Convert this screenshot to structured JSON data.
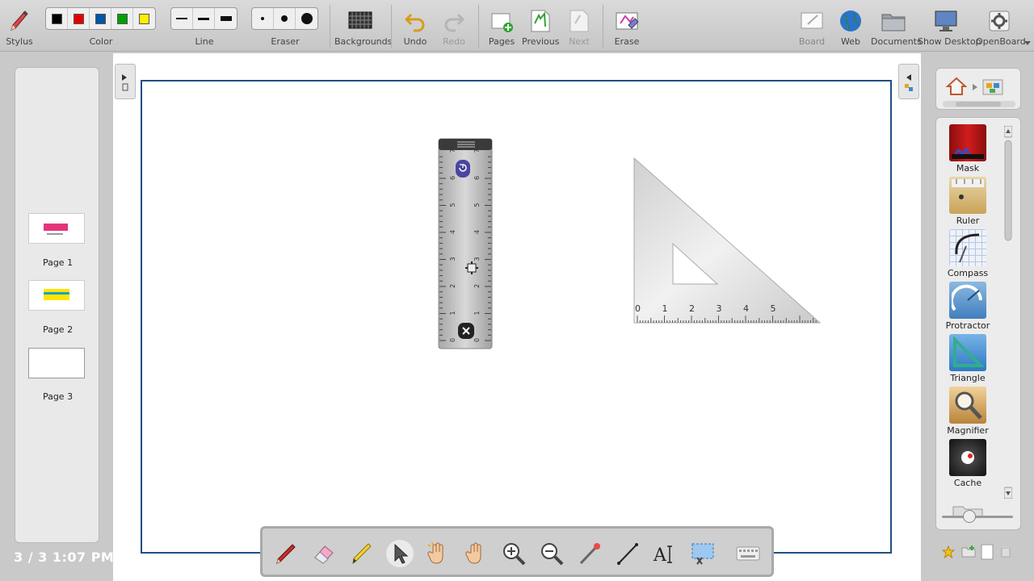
{
  "toolbar": {
    "stylus": "Stylus",
    "color": "Color",
    "line": "Line",
    "eraser": "Eraser",
    "backgrounds": "Backgrounds",
    "undo": "Undo",
    "redo": "Redo",
    "pages": "Pages",
    "previous": "Previous",
    "next": "Next",
    "erase": "Erase",
    "board": "Board",
    "web": "Web",
    "documents": "Documents",
    "show_desktop": "Show Desktop",
    "openboard": "OpenBoard",
    "colors": [
      "#000000",
      "#e60000",
      "#0055a5",
      "#00a000",
      "#ffee00"
    ]
  },
  "pages": [
    {
      "label": "Page 1"
    },
    {
      "label": "Page 2"
    },
    {
      "label": "Page 3"
    }
  ],
  "status": {
    "clock": "3 / 3 1:07 PM"
  },
  "ruler": {
    "ticks": [
      "0",
      "1",
      "2",
      "3",
      "4",
      "5",
      "6",
      "7"
    ]
  },
  "triangle": {
    "ticks": [
      "0",
      "1",
      "2",
      "3",
      "4",
      "5"
    ]
  },
  "library": {
    "items": [
      {
        "label": "Mask"
      },
      {
        "label": "Ruler"
      },
      {
        "label": "Compass"
      },
      {
        "label": "Protractor"
      },
      {
        "label": "Triangle"
      },
      {
        "label": "Magnifier"
      },
      {
        "label": "Cache"
      }
    ]
  },
  "colors": {
    "frame": "#1f4f82",
    "accent": "#e4337a"
  }
}
